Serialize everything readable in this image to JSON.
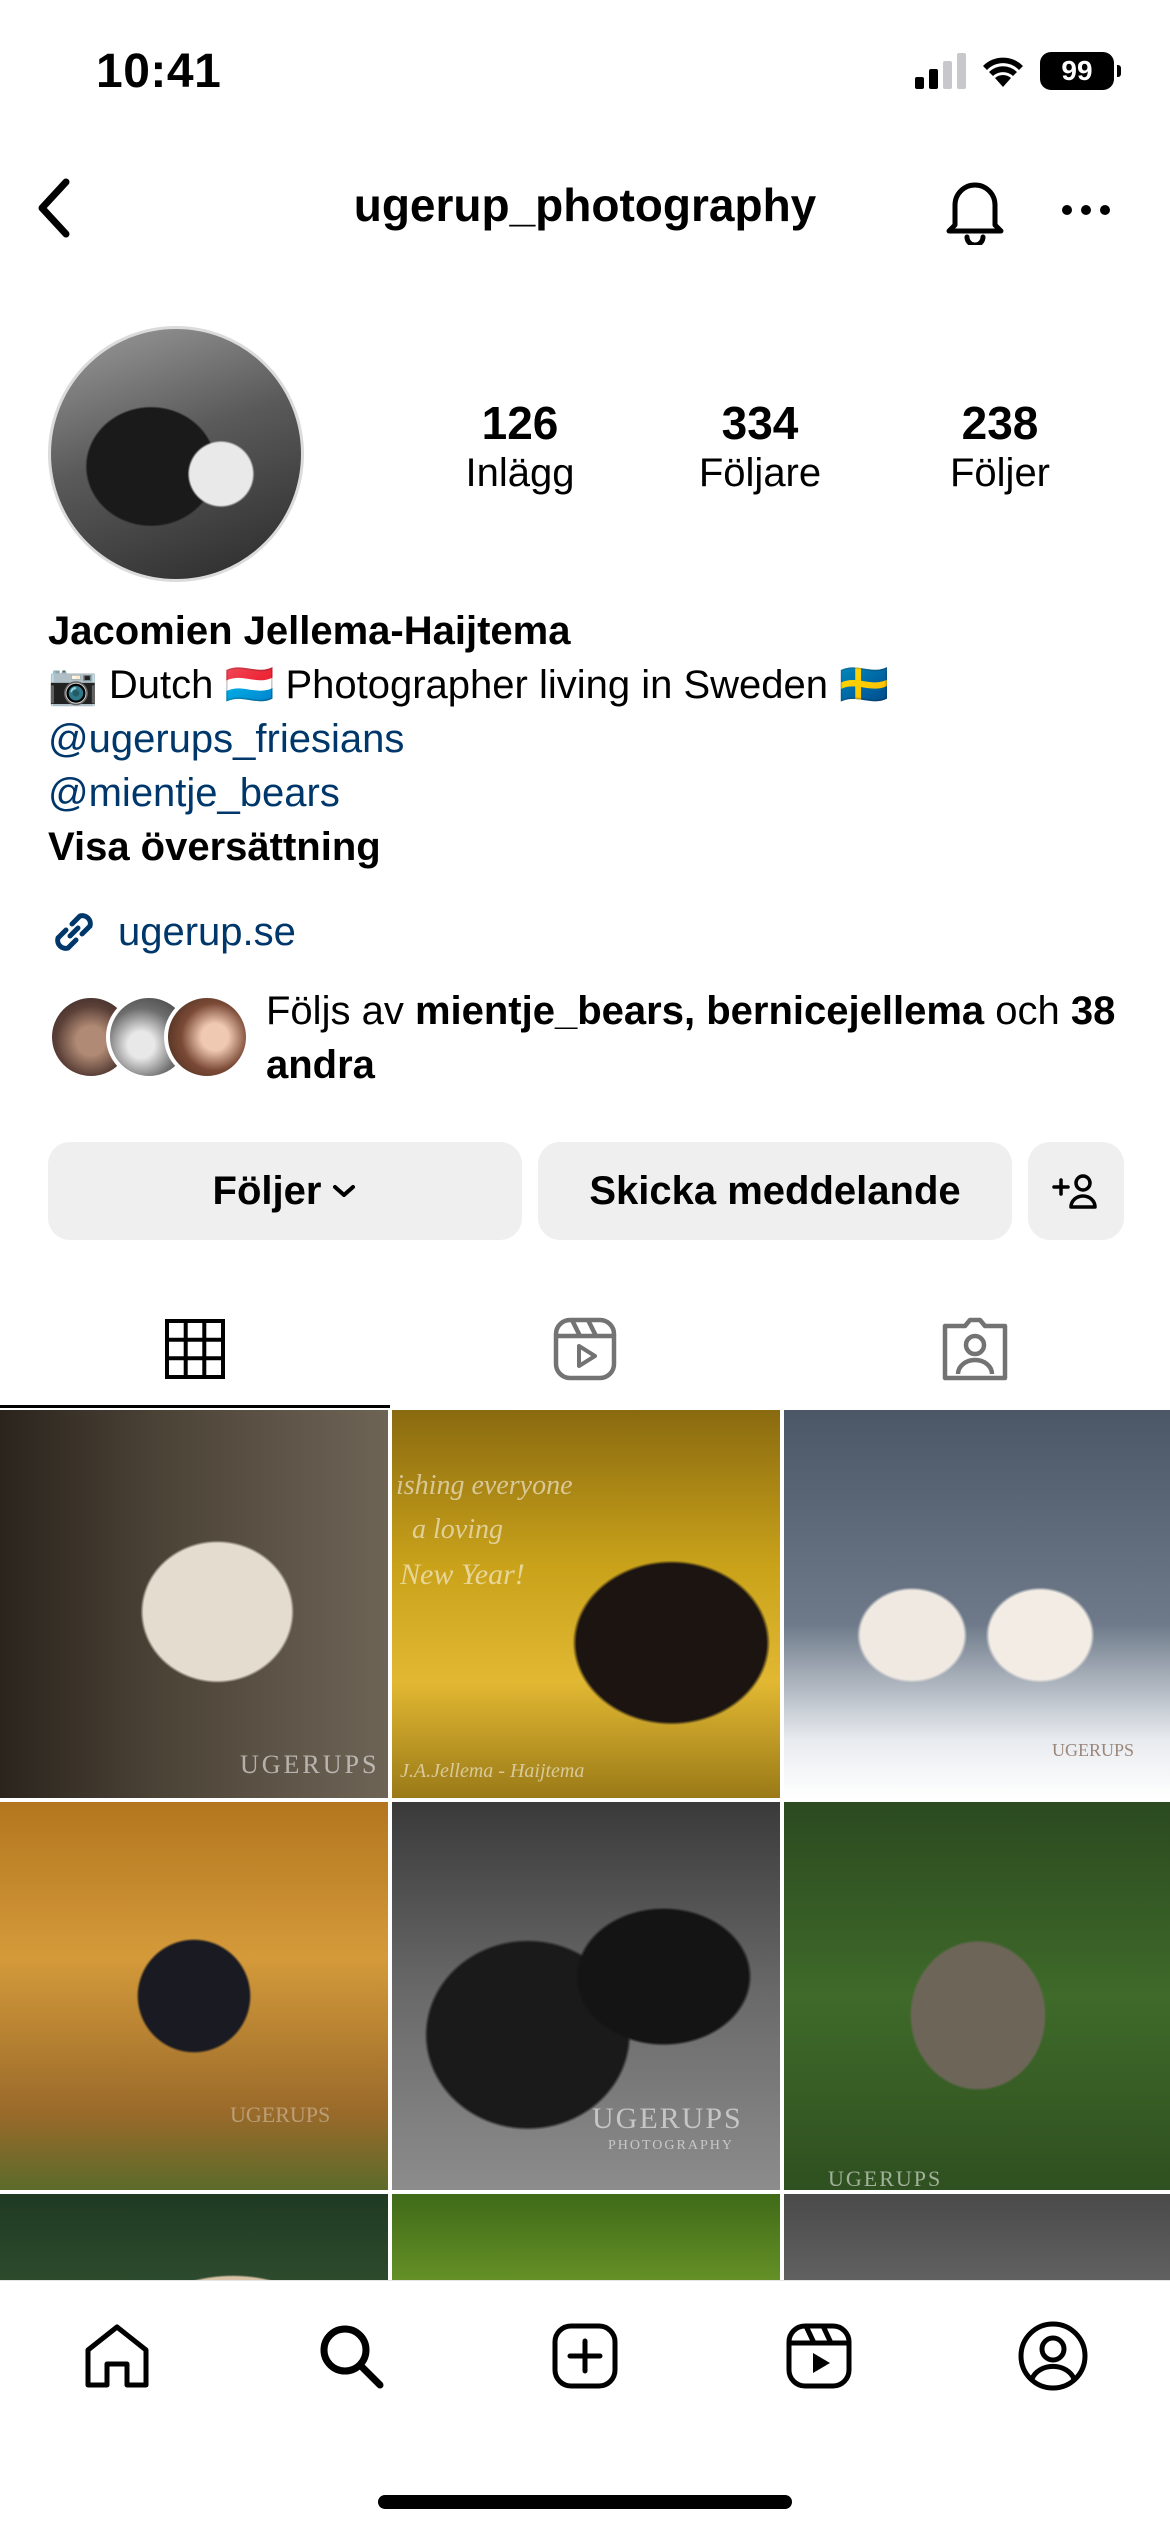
{
  "status_bar": {
    "time": "10:41",
    "battery": "99"
  },
  "header": {
    "username": "ugerup_photography"
  },
  "stats": [
    {
      "count": "126",
      "label": "Inlägg"
    },
    {
      "count": "334",
      "label": "Följare"
    },
    {
      "count": "238",
      "label": "Följer"
    }
  ],
  "bio": {
    "name": "Jacomien Jellema-Haijtema",
    "line1": "📷 Dutch 🇱🇺 Photographer living in Sweden 🇸🇪",
    "mention1": "@ugerups_friesians",
    "mention2": "@mientje_bears",
    "translate": "Visa översättning",
    "website": "ugerup.se"
  },
  "followed_by": {
    "prefix": "Följs av ",
    "user1": "mientje_bears",
    "sep": ", ",
    "user2": "bernicejellema",
    "and": " och ",
    "others": "38 andra"
  },
  "actions": {
    "follow_label": "Följer",
    "message_label": "Skicka meddelande"
  },
  "tabs": [
    "grid-icon",
    "reels-icon",
    "tagged-icon"
  ],
  "grid_watermarks": {
    "p1": "UGERUPS",
    "p2_line1": "ishing everyone",
    "p2_line2": "a loving",
    "p2_line3": "New Year!",
    "p2_sig": "J.A.Jellema - Haijtema",
    "p3": "UGERUPS",
    "p4": "UGERUPS",
    "p5": "UGERUPS",
    "p5_sub": "PHOTOGRAPHY",
    "p6": "UGERUPS"
  },
  "bottom_nav": [
    "home-icon",
    "search-icon",
    "create-icon",
    "reels-icon",
    "profile-icon"
  ]
}
